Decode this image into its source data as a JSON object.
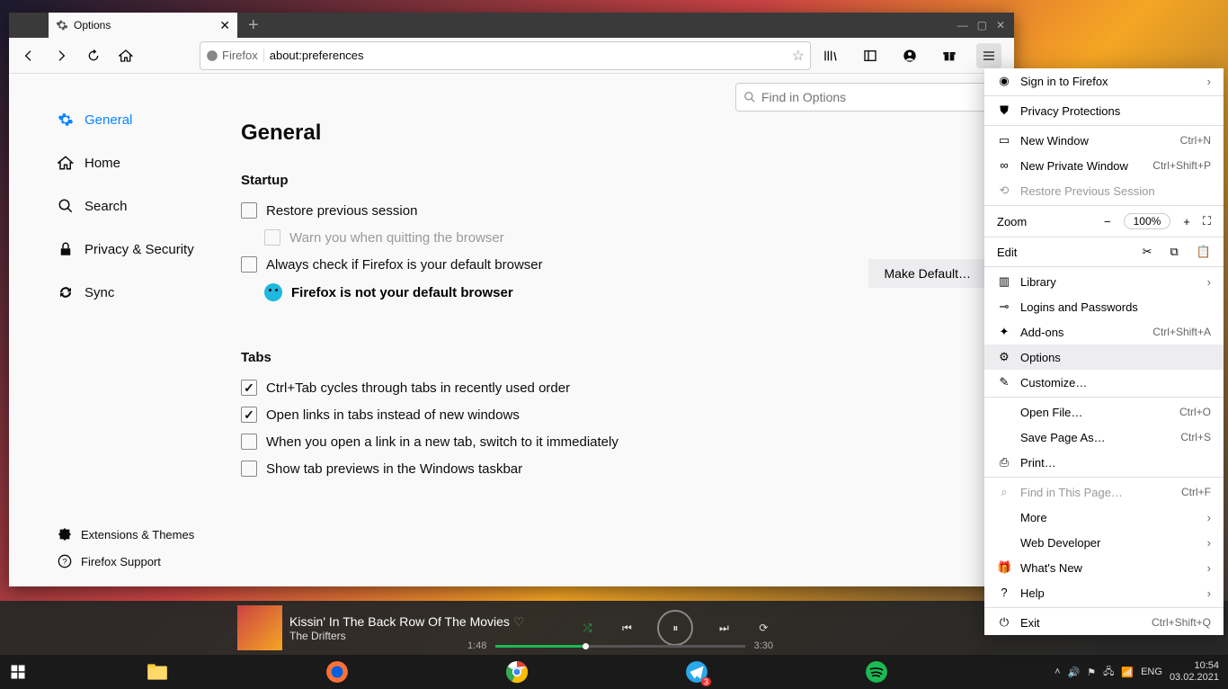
{
  "tab": {
    "title": "Options"
  },
  "url": {
    "identity": "Firefox",
    "address": "about:preferences"
  },
  "search_placeholder": "Find in Options",
  "sidebar": {
    "general": "General",
    "home": "Home",
    "search": "Search",
    "privacy": "Privacy & Security",
    "sync": "Sync",
    "extensions": "Extensions & Themes",
    "support": "Firefox Support"
  },
  "page": {
    "heading": "General",
    "startup": {
      "title": "Startup",
      "restore": "Restore previous session",
      "warn": "Warn you when quitting the browser",
      "always_check": "Always check if Firefox is your default browser",
      "not_default": "Firefox is not your default browser",
      "make_default": "Make Default…"
    },
    "tabs": {
      "title": "Tabs",
      "ctrl_tab": "Ctrl+Tab cycles through tabs in recently used order",
      "open_links": "Open links in tabs instead of new windows",
      "switch": "When you open a link in a new tab, switch to it immediately",
      "previews": "Show tab previews in the Windows taskbar"
    }
  },
  "menu": {
    "signin": "Sign in to Firefox",
    "privacy": "Privacy Protections",
    "new_window": {
      "label": "New Window",
      "shortcut": "Ctrl+N"
    },
    "new_private": {
      "label": "New Private Window",
      "shortcut": "Ctrl+Shift+P"
    },
    "restore": "Restore Previous Session",
    "zoom": {
      "label": "Zoom",
      "value": "100%"
    },
    "edit": {
      "label": "Edit"
    },
    "library": "Library",
    "logins": "Logins and Passwords",
    "addons": {
      "label": "Add-ons",
      "shortcut": "Ctrl+Shift+A"
    },
    "options": "Options",
    "customize": "Customize…",
    "open_file": {
      "label": "Open File…",
      "shortcut": "Ctrl+O"
    },
    "save_page": {
      "label": "Save Page As…",
      "shortcut": "Ctrl+S"
    },
    "print": "Print…",
    "find": {
      "label": "Find in This Page…",
      "shortcut": "Ctrl+F"
    },
    "more": "More",
    "web_dev": "Web Developer",
    "whats_new": "What's New",
    "help": "Help",
    "exit": {
      "label": "Exit",
      "shortcut": "Ctrl+Shift+Q"
    }
  },
  "player": {
    "title": "Kissin' In The Back Row Of The Movies",
    "artist": "The Drifters",
    "elapsed": "1:48",
    "total": "3:30"
  },
  "tray": {
    "lang": "ENG",
    "time": "10:54",
    "date": "03.02.2021"
  }
}
